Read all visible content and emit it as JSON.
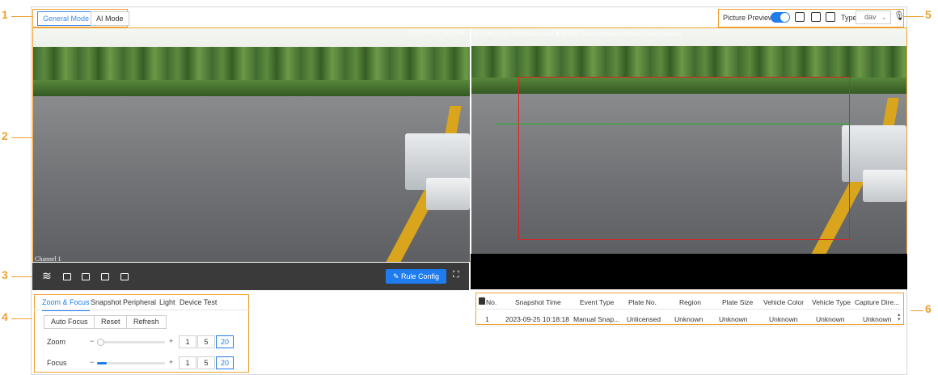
{
  "callouts": [
    "1",
    "2",
    "3",
    "4",
    "5",
    "6"
  ],
  "modes": {
    "general": "General Mode",
    "ai": "AI Mode"
  },
  "topbar": {
    "preview_label": "Picture Preview",
    "type_label": "Type",
    "type_value": "dav"
  },
  "video": {
    "left_timestamp": "2023-09-25 10:11:49",
    "right_overlay": "2023-09-25 10:18:18 Unlicensed  浙安微位  Manual Snapshot  Vehicle Type  Unknown",
    "channel_label": "Channel 1"
  },
  "toolbar": {
    "rule_config": "Rule Config"
  },
  "tabs": [
    "Zoom & Focus",
    "Snapshot",
    "Peripheral",
    "Light",
    "Device Test"
  ],
  "buttons": {
    "auto_focus": "Auto Focus",
    "reset": "Reset",
    "refresh": "Refresh"
  },
  "zoom": {
    "label": "Zoom",
    "minus": "−",
    "plus": "+",
    "steps": [
      "1",
      "5",
      "20"
    ],
    "active_step": "20",
    "level": 0.0
  },
  "focus": {
    "label": "Focus",
    "minus": "−",
    "plus": "+",
    "steps": [
      "1",
      "5",
      "20"
    ],
    "active_step": "20",
    "level": 0.14
  },
  "table": {
    "headers": [
      "No.",
      "Snapshot Time",
      "Event Type",
      "Plate No.",
      "Region",
      "Plate Size",
      "Vehicle Color",
      "Vehicle Type",
      "Capture Dire..."
    ],
    "rows": [
      [
        "1",
        "2023-09-25 10:18:18",
        "Manual Snap...",
        "Unlicensed",
        "Unknown",
        "Unknown",
        "Unknown",
        "Unknown",
        "Unknown"
      ]
    ]
  },
  "colors": {
    "accent": "#1e7cf0",
    "callout": "#f0a030",
    "toolbar_bg": "#3a3a3a"
  }
}
